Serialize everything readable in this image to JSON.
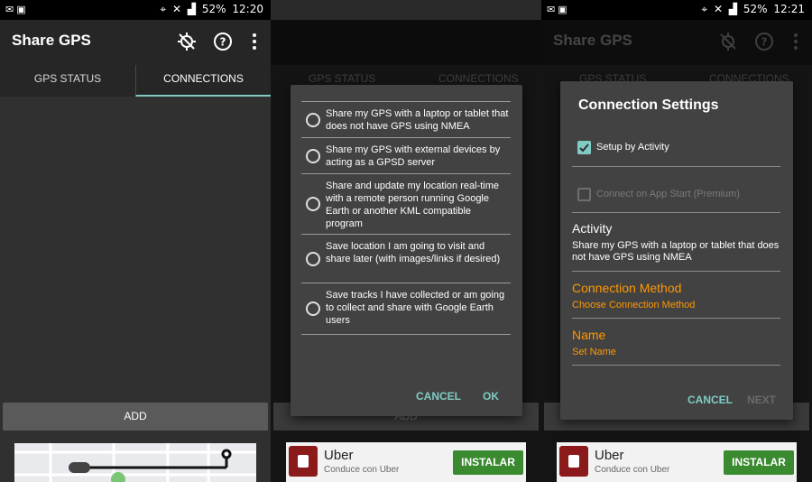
{
  "status_bar": {
    "left_icons": "✉ ▣",
    "battery": "52%",
    "time_1": "12:20",
    "time_3": "12:21"
  },
  "app": {
    "title": "Share GPS",
    "icons": [
      "gps-off-icon",
      "help-icon",
      "more-vert-icon"
    ]
  },
  "tabs": [
    "GPS STATUS",
    "CONNECTIONS"
  ],
  "add_button": "ADD",
  "activity_dialog": {
    "options": [
      "Share my GPS with a laptop or tablet that does not have GPS using NMEA",
      "Share my GPS with external devices by acting as a GPSD server",
      "Share and update my location real-time with a remote person running Google Earth or another KML compatible program",
      "Save location I am going to visit and share later (with images/links if desired)",
      "Save tracks I have collected or am going to collect and share with Google Earth users"
    ],
    "cancel": "CANCEL",
    "ok": "OK"
  },
  "ad": {
    "name": "Uber",
    "subtitle": "Conduce con Uber",
    "install": "INSTALAR"
  },
  "connection_settings": {
    "title": "Connection Settings",
    "setup_by_activity": "Setup by Activity",
    "setup_checked": true,
    "connect_on_start": "Connect on App Start (Premium)",
    "connect_checked": false,
    "activity_heading": "Activity",
    "activity_value": "Share my GPS with a laptop or tablet that does not have GPS using NMEA",
    "method_heading": "Connection Method",
    "method_value": "Choose Connection Method",
    "name_heading": "Name",
    "name_value": "Set Name",
    "cancel": "CANCEL",
    "next": "NEXT"
  },
  "colors": {
    "accent": "#80cbc4",
    "orange": "#ff9800",
    "install_green": "#3a8a30"
  }
}
